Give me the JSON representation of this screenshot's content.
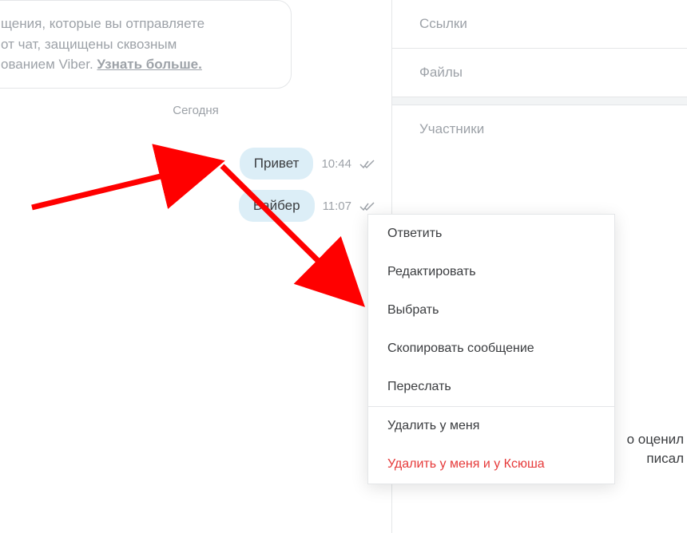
{
  "colors": {
    "muted": "#9da2a8",
    "bubble": "#dceef7",
    "text": "#3a3c3f",
    "danger": "#e63939",
    "border": "#e4e6e8"
  },
  "chat": {
    "encryption_notice_line1": "щения, которые вы отправляете",
    "encryption_notice_line2": "от чат, защищены сквозным",
    "encryption_notice_line3": "ованием Viber. ",
    "encryption_link": "Узнать больше.",
    "date_label": "Сегодня",
    "messages": [
      {
        "text": "Привет",
        "time": "10:44"
      },
      {
        "text": "Вайбер",
        "time": "11:07"
      }
    ]
  },
  "sidebar": {
    "links": "Ссылки",
    "files": "Файлы",
    "members": "Участники"
  },
  "behind_menu": {
    "line1": "о оценил",
    "line2": "писал"
  },
  "context_menu": {
    "reply": "Ответить",
    "edit": "Редактировать",
    "select": "Выбрать",
    "copy": "Скопировать сообщение",
    "forward": "Переслать",
    "delete_me": "Удалить у меня",
    "delete_both": "Удалить у меня и у Ксюша"
  }
}
